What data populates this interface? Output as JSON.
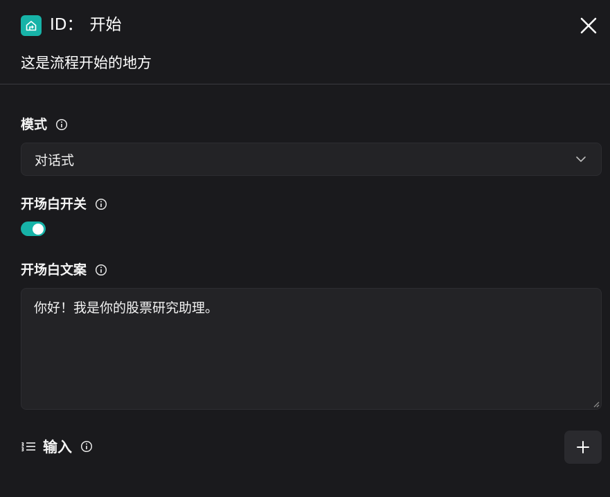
{
  "header": {
    "icon": "home-flow-icon",
    "id_label": "ID：",
    "node_name": "开始",
    "description": "这是流程开始的地方",
    "close_icon": "close-icon"
  },
  "mode": {
    "label": "模式",
    "selected": "对话式"
  },
  "opening_switch": {
    "label": "开场白开关",
    "enabled": true
  },
  "opening_text": {
    "label": "开场白文案",
    "value": "你好！我是你的股票研究助理。"
  },
  "inputs": {
    "label": "输入",
    "add_icon": "plus-icon"
  },
  "colors": {
    "accent": "#17b3a8",
    "background": "#1a1a1d",
    "field": "#232326"
  }
}
